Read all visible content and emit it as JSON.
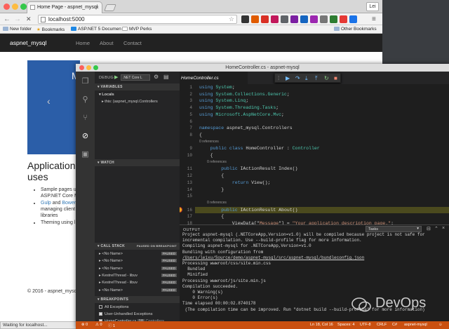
{
  "browser": {
    "tab_title": "Home Page - aspnet_mysql",
    "tab_close": "×",
    "user_label": "Lei",
    "back": "←",
    "forward": "→",
    "reload": "✕",
    "url": "localhost:5000",
    "star": "☆",
    "bookmarks": [
      {
        "label": "New folder"
      },
      {
        "label": "Bookmarks"
      },
      {
        "label": "ASP.NET 5 Documen"
      },
      {
        "label": "MVP Perks"
      }
    ],
    "other_bookmarks": "Other Bookmarks",
    "status": "Waiting for localhost...",
    "colors": {
      "site_nav": "#222222",
      "carousel": "#2b5ea8",
      "link": "#337ab7"
    }
  },
  "site": {
    "brand": "aspnet_mysql",
    "nav": [
      "Home",
      "About",
      "Contact"
    ],
    "carousel_letter": "M",
    "carousel_prev": "‹",
    "heading": "Application uses",
    "list": [
      {
        "text": "Sample pages u",
        "text2": "ASP.NET Core M"
      },
      {
        "link1": "Gulp",
        "mid": " and ",
        "link2": "Bower",
        "text2": "managing client",
        "text3": "libraries"
      },
      {
        "text": "Theming using l"
      }
    ],
    "footer": "© 2016 - aspnet_mysql"
  },
  "vscode": {
    "window_title": "HomeController.cs - aspnet-mysql",
    "debug_label": "DEBUG",
    "debug_config": ".NET Core L",
    "sections": {
      "variables": "VARIABLES",
      "locals": "Locals",
      "this_var": "this: {aspnet_mysql.Controllers",
      "watch": "WATCH",
      "call_stack": "CALL STACK",
      "paused_on_breakpoint": "PAUSED ON BREAKPOINT",
      "breakpoints": "BREAKPOINTS"
    },
    "call_stack": [
      {
        "name": "<No Name>",
        "state": "PAUSED"
      },
      {
        "name": "<No Name>",
        "state": "PAUSED"
      },
      {
        "name": "<No Name>",
        "state": "PAUSED"
      },
      {
        "name": "KestrelThread - libuv",
        "state": "PAUSED"
      },
      {
        "name": "KestrelThread - libuv",
        "state": "PAUSED"
      },
      {
        "name": "<No Name>",
        "state": "PAUSED"
      }
    ],
    "breakpoints": [
      {
        "label": "All Exceptions",
        "checked": false,
        "line": ""
      },
      {
        "label": "User-Unhandled Exceptions",
        "checked": true,
        "line": ""
      },
      {
        "label": "HomeController.cs",
        "checked": true,
        "line": "18",
        "folder": "Controllers"
      }
    ],
    "editor_tab": "HomeController.cs",
    "code_lines": [
      {
        "num": "1",
        "t": [
          [
            "kw",
            "using "
          ],
          [
            "ty",
            "System"
          ],
          [
            "",
            "; "
          ]
        ]
      },
      {
        "num": "2",
        "t": [
          [
            "kw",
            "using "
          ],
          [
            "ty",
            "System.Collections.Generic"
          ],
          [
            "",
            ";"
          ]
        ]
      },
      {
        "num": "3",
        "t": [
          [
            "kw",
            "using "
          ],
          [
            "ty",
            "System.Linq"
          ],
          [
            "",
            ";"
          ]
        ]
      },
      {
        "num": "4",
        "t": [
          [
            "kw",
            "using "
          ],
          [
            "ty",
            "System.Threading.Tasks"
          ],
          [
            "",
            ";"
          ]
        ]
      },
      {
        "num": "5",
        "t": [
          [
            "kw",
            "using "
          ],
          [
            "ty",
            "Microsoft.AspNetCore.Mvc"
          ],
          [
            "",
            ";"
          ]
        ]
      },
      {
        "num": "6",
        "t": []
      },
      {
        "num": "7",
        "t": [
          [
            "kw",
            "namespace "
          ],
          [
            "",
            "aspnet_mysql.Controllers"
          ]
        ]
      },
      {
        "num": "8",
        "t": [
          [
            "",
            "{"
          ]
        ]
      },
      {
        "num": "",
        "lens": "0 references"
      },
      {
        "num": "9",
        "t": [
          [
            "",
            "    "
          ],
          [
            "kw",
            "public class "
          ],
          [
            "",
            "HomeController : "
          ],
          [
            "ty",
            "Controller"
          ]
        ]
      },
      {
        "num": "10",
        "t": [
          [
            "",
            "    {"
          ]
        ]
      },
      {
        "num": "",
        "lens": "        0 references"
      },
      {
        "num": "11",
        "t": [
          [
            "",
            "        "
          ],
          [
            "kw",
            "public "
          ],
          [
            "",
            "IActionResult Index()"
          ]
        ]
      },
      {
        "num": "12",
        "t": [
          [
            "",
            "        {"
          ]
        ]
      },
      {
        "num": "13",
        "t": [
          [
            "",
            "            "
          ],
          [
            "kw",
            "return "
          ],
          [
            "",
            "View();"
          ]
        ]
      },
      {
        "num": "14",
        "t": [
          [
            "",
            "        }"
          ]
        ]
      },
      {
        "num": "15",
        "t": []
      },
      {
        "num": "",
        "lens": "        0 references"
      },
      {
        "num": "16",
        "t": [
          [
            "",
            "        "
          ],
          [
            "kw",
            "public "
          ],
          [
            "",
            "IActionResult About()"
          ]
        ]
      },
      {
        "num": "17",
        "t": [
          [
            "",
            "        {"
          ]
        ]
      },
      {
        "num": "18",
        "t": [
          [
            "",
            "            ViewData[\""
          ],
          [
            "st",
            "Message"
          ],
          [
            "",
            "\"] = "
          ],
          [
            "st",
            "\"Your application description page.\""
          ],
          [
            "",
            ";"
          ]
        ]
      }
    ],
    "output_label": "OUTPUT",
    "output_channel": "Tasks",
    "output_lines": [
      "Project aspnet-mysql (.NETCoreApp,Version=v1.0) will be compiled because project is not safe for",
      "incremental compilation. Use --build-profile flag for more information.",
      "Compiling aspnet-mysql for .NETCoreApp,Version=v1.0",
      "Bundling with configuration from",
      "/Users/leixu/Source/demo/aspnet-mysql/src/aspnet-mysql/bundleconfig.json",
      "Processing wwwroot/css/site.min.css",
      "  Bundled",
      "  Minified",
      "Processing wwwroot/js/site.min.js",
      "Compilation succeeded.",
      "    0 Warning(s)",
      "    0 Error(s)",
      "Time elapsed 00:00:02.8740178",
      " (The compilation time can be improved. Run \"dotnet build --build-profile\" for more information)"
    ],
    "status": {
      "errors": "⊗ 0",
      "warnings": "⚠ 0",
      "info": "ⓘ 1",
      "position": "Ln 18, Col 16",
      "spaces": "Spaces: 4",
      "encoding": "UTF-8",
      "eol": "CRLF",
      "language": "C#",
      "project": "aspnet-mysql",
      "smile": "☺"
    },
    "colors": {
      "status": "#ca5010",
      "keyword": "#569cd6",
      "type": "#4ec9b0",
      "string": "#ce9178",
      "highlight": "#4b4a1e"
    }
  },
  "watermark": "DevOps"
}
